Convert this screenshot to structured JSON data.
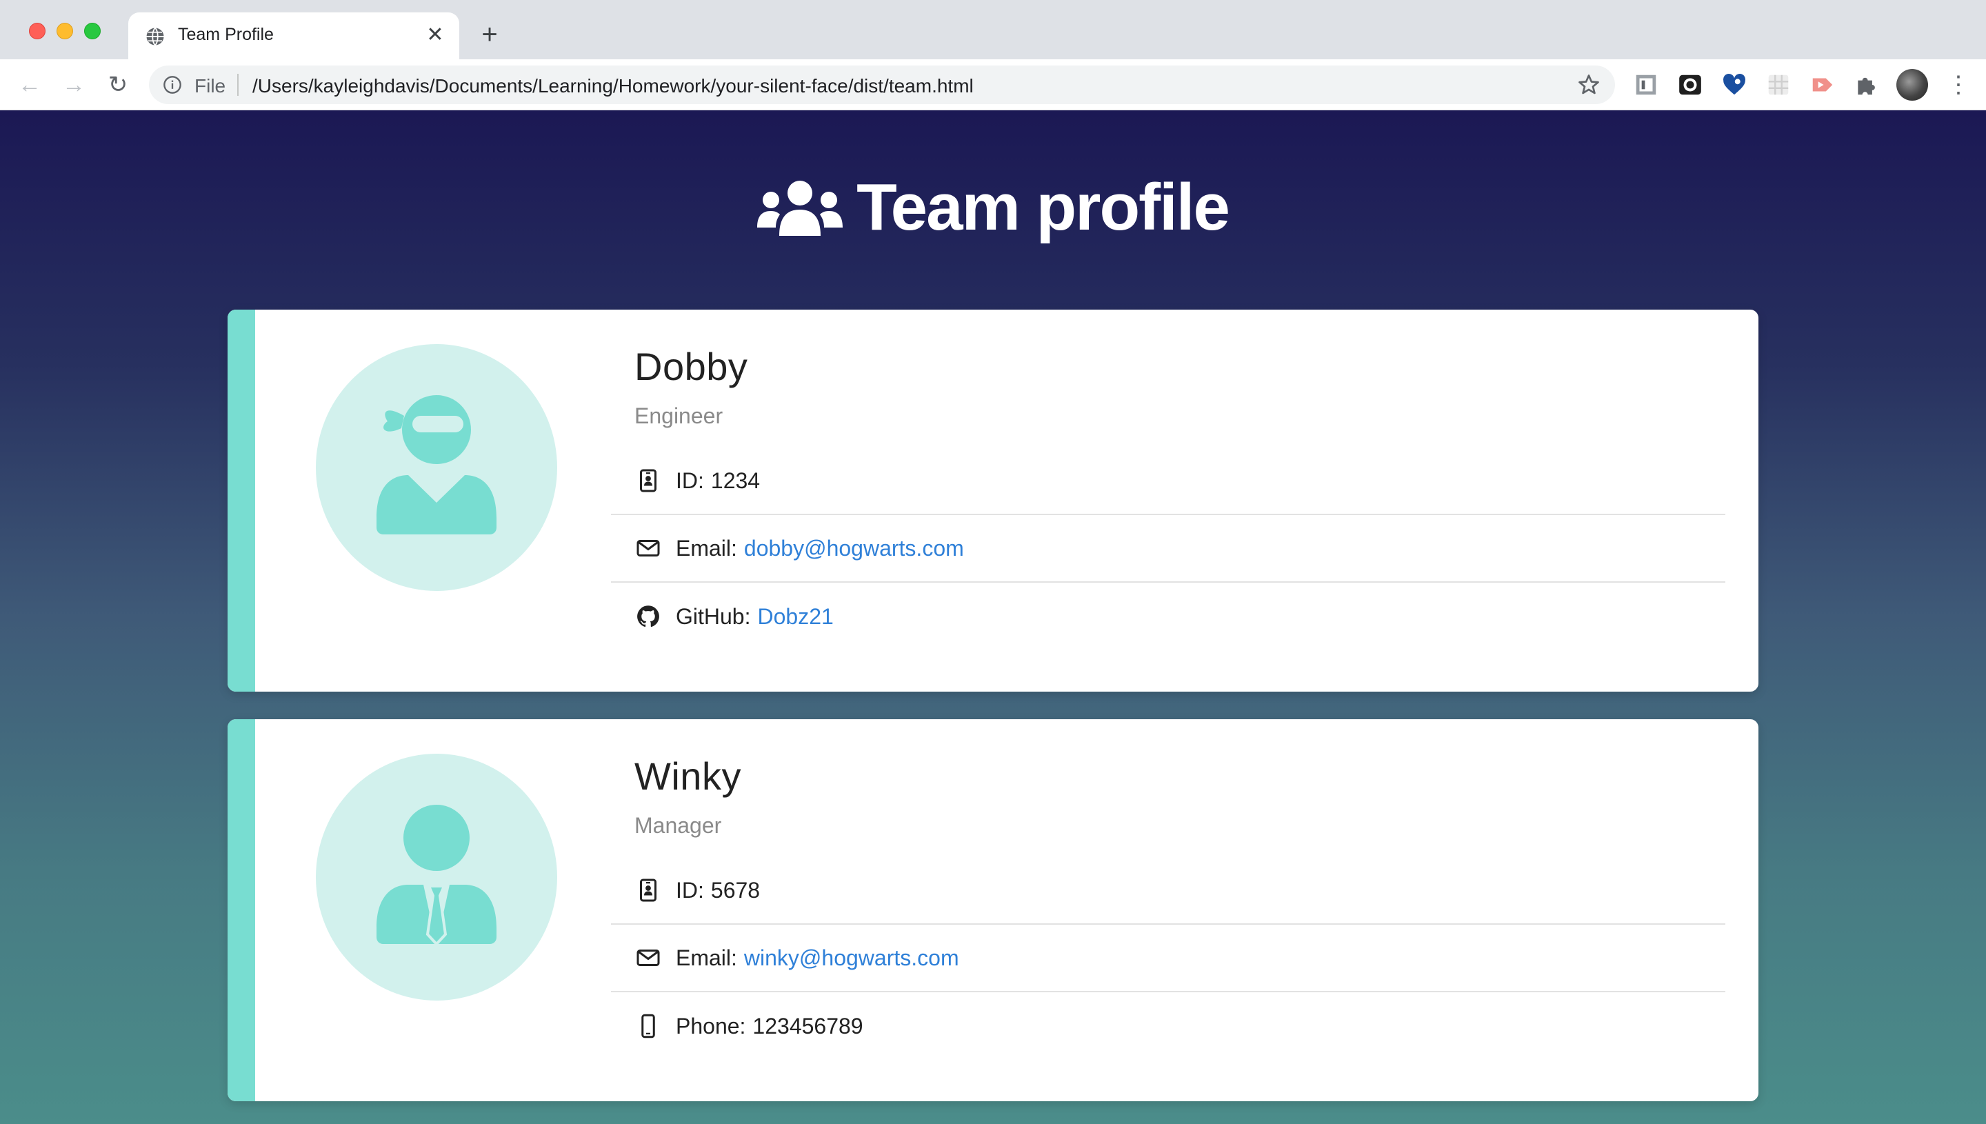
{
  "browser": {
    "tab_title": "Team Profile",
    "scheme_label": "File",
    "url": "/Users/kayleighdavis/Documents/Learning/Homework/your-silent-face/dist/team.html",
    "new_tab_label": "+",
    "close_tab_label": "✕",
    "back_label": "←",
    "forward_label": "→",
    "reload_label": "↻",
    "menu_label": "⋮",
    "extensions": [
      "rp-extension-icon",
      "camera-extension-icon",
      "heart-extension-icon",
      "grid-extension-icon",
      "play-extension-icon",
      "puzzle-icon"
    ]
  },
  "page": {
    "title": "Team profile",
    "icon": "users-icon",
    "accent_color": "#78ddd1",
    "link_color": "#2f80d8"
  },
  "team": [
    {
      "name": "Dobby",
      "role": "Engineer",
      "avatar": "ninja-icon",
      "id_label": "ID:",
      "id": "1234",
      "email_label": "Email:",
      "email": "dobby@hogwarts.com",
      "extra_label": "GitHub:",
      "extra_value": "Dobz21",
      "extra_icon": "github-icon"
    },
    {
      "name": "Winky",
      "role": "Manager",
      "avatar": "businessman-icon",
      "id_label": "ID:",
      "id": "5678",
      "email_label": "Email:",
      "email": "winky@hogwarts.com",
      "extra_label": "Phone:",
      "extra_value": "123456789",
      "extra_icon": "mobile-phone-icon"
    }
  ]
}
